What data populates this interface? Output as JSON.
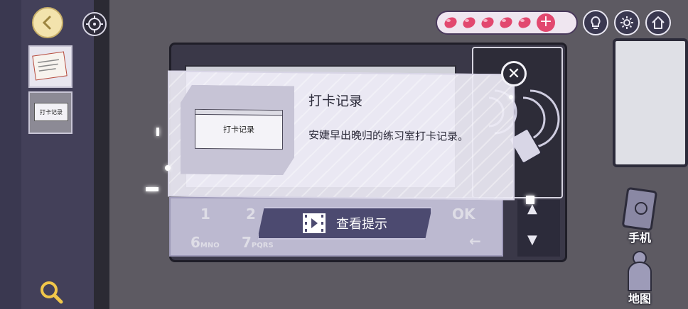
{
  "dialog": {
    "title": "打卡记录",
    "description": "安婕早出晚归的练习室打卡记录。",
    "item_card_label": "打卡记录"
  },
  "hint_button": {
    "label": "查看提示"
  },
  "inventory": {
    "thumb2_label": "打卡记录"
  },
  "side_nav": {
    "phone_label": "手机",
    "map_label": "地图"
  },
  "hearts": {
    "count": 5,
    "color": "#e2486f"
  },
  "keypad": {
    "keys": [
      "1",
      "2",
      "OK",
      "6",
      "7",
      "←"
    ],
    "key_subs": [
      "MNO",
      "PQRS"
    ]
  },
  "colors": {
    "accent": "#4c4a70",
    "panel": "#434059",
    "background": "#5d5a62"
  }
}
